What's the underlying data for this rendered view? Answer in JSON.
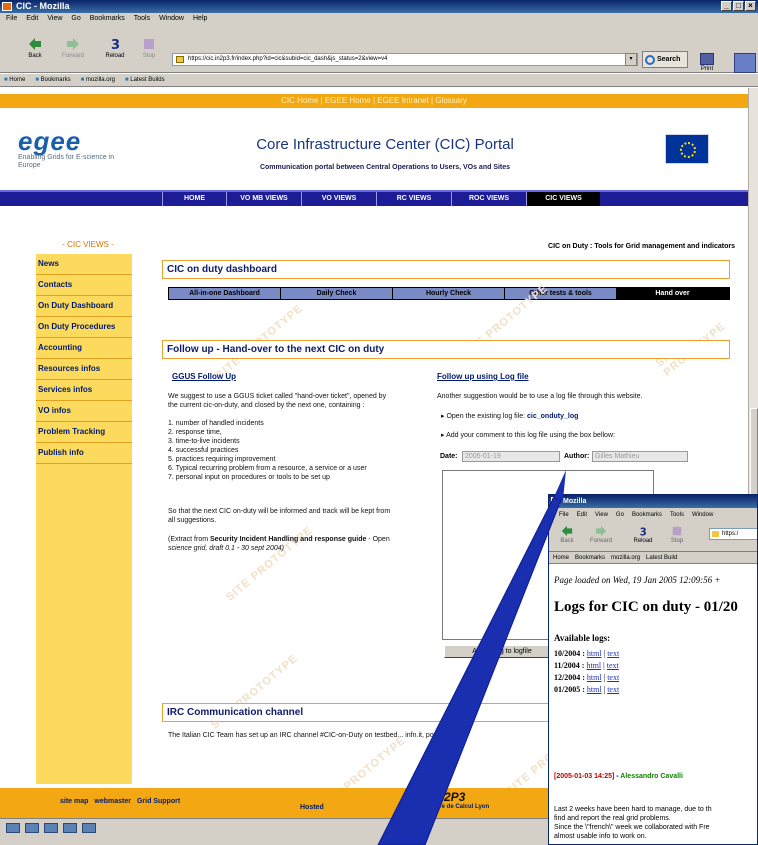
{
  "browser": {
    "window_title": "CIC - Mozilla",
    "window_controls": [
      "_",
      "□",
      "×"
    ],
    "menu": [
      "File",
      "Edit",
      "View",
      "Go",
      "Bookmarks",
      "Tools",
      "Window",
      "Help"
    ],
    "nav_buttons": {
      "back": "Back",
      "forward": "Forward",
      "reload": "Reload",
      "stop": "Stop",
      "search": "Search",
      "print": "Print"
    },
    "url": "https://cic.in2p3.fr/index.php?id=cic&subid=cic_dash&js_status=2&view=v4",
    "url_dropdown": "▾",
    "bookmarks": [
      "Home",
      "Bookmarks",
      "mozilla.org",
      "Latest Builds"
    ]
  },
  "page": {
    "top_links": "CIC Home | EGEE Home | EGEE Intranet | Glossary",
    "logo": {
      "name": "egee",
      "tagline": "Enabling Grids for E-science in Europe"
    },
    "title": "Core Infrastructure Center (CIC) Portal",
    "subtitle": "Communication portal between Central Operations to Users, VOs and Sites",
    "main_nav": [
      "HOME",
      "VO MB VIEWS",
      "VO VIEWS",
      "RC VIEWS",
      "ROC VIEWS",
      "CIC VIEWS"
    ],
    "main_nav_active": "CIC VIEWS",
    "sidebar_header": "- CIC VIEWS -",
    "sidebar": [
      "News",
      "Contacts",
      "On Duty Dashboard",
      "On Duty Procedures",
      "Accounting",
      "Resources infos",
      "Services infos",
      "VO infos",
      "Problem Tracking",
      "Publish info"
    ],
    "breadcrumb_right": "CIC on Duty : Tools for Grid management and indicators",
    "dashboard_title": "CIC on duty dashboard",
    "subtabs": [
      "All-in-one Dashboard",
      "Daily Check",
      "Hourly Check",
      "Other tests & tools",
      "Hand over"
    ],
    "subtab_active": "Hand over",
    "followup_title": "Follow up - Hand-over to the next CIC on duty",
    "ggus": {
      "heading": "GGUS Follow Up",
      "intro_1": "We suggest to use a GGUS ticket called \"hand-over ticket\", opened by",
      "intro_2": "the current cic-on-duty, and closed by the next one, containing :",
      "items": [
        "1. number of handled incidents",
        "2. response time,",
        "3. time-to-live incidents",
        "4. successful practices",
        "5. practices requiring improvement",
        "6. Typical recurring problem from a resource, a service or a user",
        "7. personal input on procedures or tools to be set up"
      ],
      "so_that_1": "So that the next CIC on-duty will be informed and track will be kept from",
      "so_that_2": "all suggestions.",
      "extract_1_pre": "(Extract from ",
      "extract_1_bold": "Security Incident Handling and response guide",
      "extract_1_post": " - Open",
      "extract_2": "science grid, draft 0.1 - 30 sept 2004)"
    },
    "logfile": {
      "heading": "Follow up using Log file",
      "intro": "Another suggestion would be to use a log file through this website.",
      "open_pre": "Open the existing log file: ",
      "open_link": "cic_onduty_log",
      "add": "Add your comment to this log file using the box bellow:",
      "date_label": "Date:",
      "date_value": "2005-01-19",
      "author_label": "Author:",
      "author_value": "Gilles Mathieu",
      "add_button": "Add ... log to logfile"
    },
    "watermark": "SITE PROTOTYPE",
    "irc_title": "IRC Communication channel",
    "irc_text": "The Italian CIC Team has set up an IRC channel #CIC-on-Duty on testbed... infn.it, port 6667",
    "footer_links": [
      "site map",
      "webmaster",
      "Grid Support"
    ],
    "footer_host": "Hosted",
    "footer_logo": "IN2P3",
    "footer_logo_sub": "Centre de Calcul Lyon"
  },
  "popup": {
    "title": "Mozilla",
    "menu": [
      "File",
      "Edit",
      "View",
      "Go",
      "Bookmarks",
      "Tools",
      "Window"
    ],
    "buttons": [
      "Back",
      "Forward",
      "Reload",
      "Stop"
    ],
    "url": "https:/",
    "bookmarks": [
      "Home",
      "Bookmarks",
      "mozilla.org",
      "Latest Build"
    ],
    "loaded": "Page loaded on Wed, 19 Jan 2005 12:09:56 +",
    "heading": "Logs for CIC on duty - 01/20",
    "available": "Available logs:",
    "logs": [
      {
        "period": "10/2004",
        "html": "html",
        "text": "text"
      },
      {
        "period": "11/2004",
        "html": "html",
        "text": "text"
      },
      {
        "period": "12/2004",
        "html": "html",
        "text": "text"
      },
      {
        "period": "01/2005",
        "html": "html",
        "text": "text"
      }
    ],
    "entry_time": "[2005-01-03 14:25]",
    "entry_sep": " - ",
    "entry_author": "Alessandro Cavalli",
    "entry_lines": [
      "Last 2 weeks have been hard to manage, due to th",
      "find and report the real grid problems.",
      "Since the \\\"french\\\" week we collaborated with Fre",
      "almost usable info to work on."
    ]
  }
}
